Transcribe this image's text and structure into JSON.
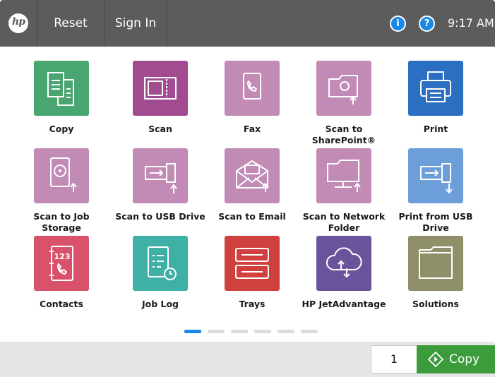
{
  "header": {
    "logo": "hp",
    "reset_label": "Reset",
    "sign_in_label": "Sign In",
    "info_icon": "i",
    "help_icon": "?",
    "time": "9:17 AM"
  },
  "apps": [
    {
      "label": "Copy",
      "color": "#4aa671",
      "icon": "copy-icon"
    },
    {
      "label": "Scan",
      "color": "#a24b91",
      "icon": "scan-icon"
    },
    {
      "label": "Fax",
      "color": "#c18bb6",
      "icon": "fax-icon"
    },
    {
      "label": "Scan to\nSharePoint®",
      "color": "#c18bb6",
      "icon": "sharepoint-icon"
    },
    {
      "label": "Print",
      "color": "#2a6fc2",
      "icon": "printer-icon"
    },
    {
      "label": "Scan to Job\nStorage",
      "color": "#c18bb6",
      "icon": "storage-icon"
    },
    {
      "label": "Scan to USB Drive",
      "color": "#c18bb6",
      "icon": "usb-icon"
    },
    {
      "label": "Scan to Email",
      "color": "#c18bb6",
      "icon": "email-icon"
    },
    {
      "label": "Scan to Network\nFolder",
      "color": "#c18bb6",
      "icon": "network-folder-icon"
    },
    {
      "label": "Print from USB\nDrive",
      "color": "#6c9fda",
      "icon": "usb-print-icon"
    },
    {
      "label": "Contacts",
      "color": "#d9516b",
      "icon": "contacts-icon"
    },
    {
      "label": "Job Log",
      "color": "#3fb0a5",
      "icon": "job-log-icon"
    },
    {
      "label": "Trays",
      "color": "#d0403e",
      "icon": "trays-icon"
    },
    {
      "label": "HP JetAdvantage",
      "color": "#69539a",
      "icon": "cloud-icon"
    },
    {
      "label": "Solutions",
      "color": "#8f9069",
      "icon": "folder-icon"
    }
  ],
  "pager": {
    "pages": 6,
    "current": 1
  },
  "footer": {
    "copies": "1",
    "copy_label": "Copy",
    "copy_color": "#3c9b3a"
  }
}
